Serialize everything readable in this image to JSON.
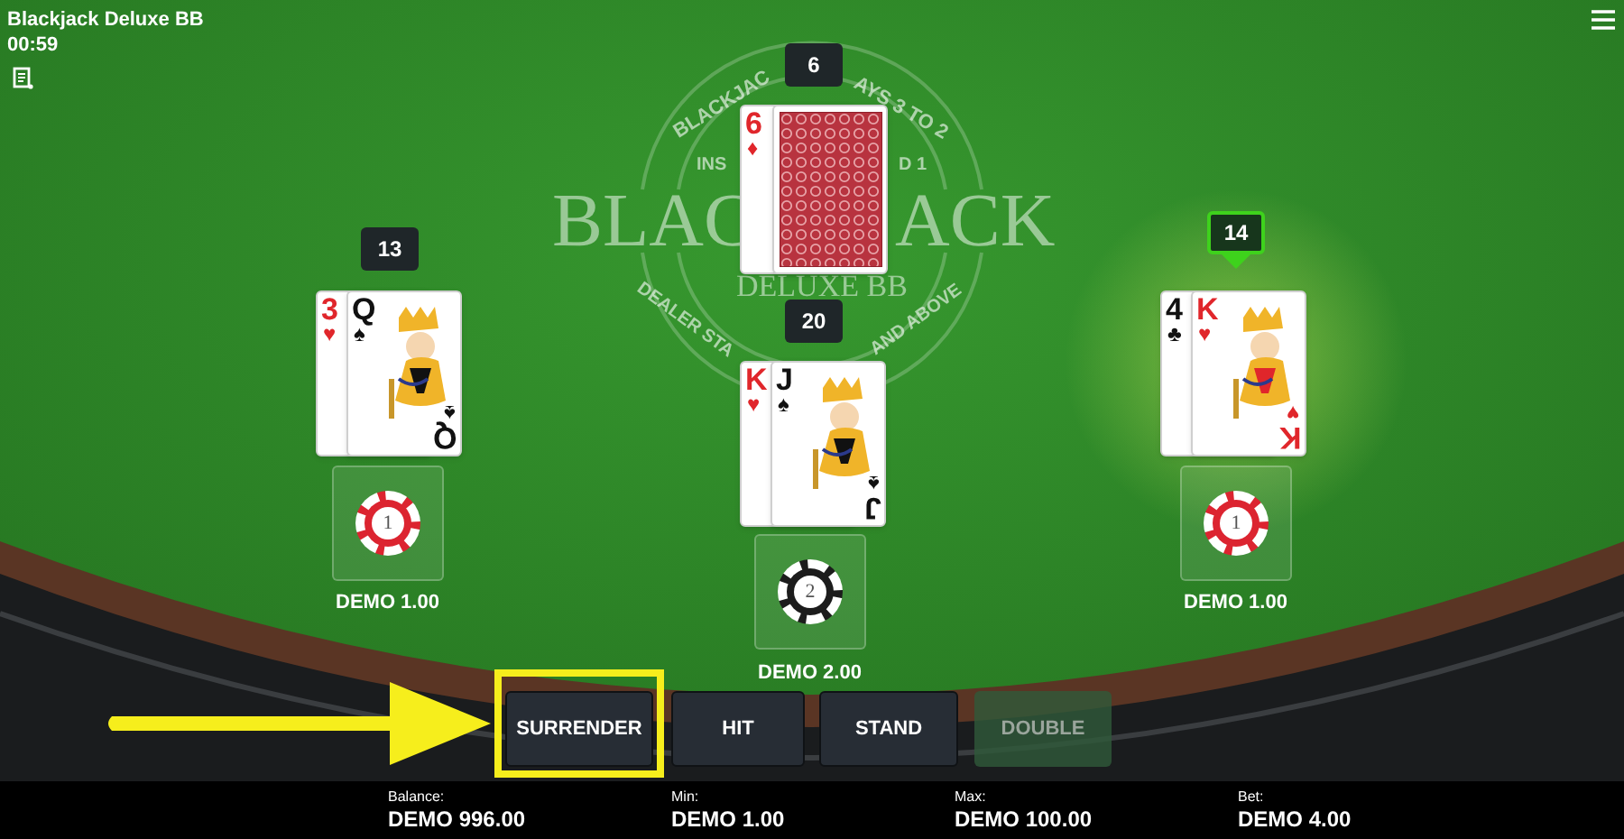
{
  "header": {
    "title": "Blackjack Deluxe BB",
    "timer": "00:59"
  },
  "table_logo": {
    "arc_top": [
      "BLACKJAC",
      "AYS 3 TO 2"
    ],
    "arc_inner": [
      "INS",
      "D 1"
    ],
    "name": [
      "BLAC",
      "ACK"
    ],
    "subtitle": "DELUXE BB",
    "arc_bottom": [
      "DEALER STA",
      "AND ABOVE"
    ]
  },
  "dealer": {
    "score": "6",
    "cards": [
      {
        "kind": "pip",
        "rank": "6",
        "suit": "♦",
        "color": "#e0262b"
      },
      {
        "kind": "back"
      }
    ]
  },
  "hands": [
    {
      "score": "13",
      "active": false,
      "bet": "DEMO 1.00",
      "chip": {
        "value": "1",
        "color": "#dc2430"
      },
      "cards": [
        {
          "kind": "pip",
          "rank": "3",
          "suit": "♥",
          "color": "#e0262b"
        },
        {
          "kind": "face",
          "rank": "Q",
          "suit": "♠",
          "color": "#111111",
          "bottom_suit": "♠",
          "bottom_rank": "Q"
        }
      ]
    },
    {
      "score": "20",
      "active": false,
      "bet": "DEMO 2.00",
      "chip": {
        "value": "2",
        "color": "#1c1c1c"
      },
      "cards": [
        {
          "kind": "pip",
          "rank": "K",
          "suit": "♥",
          "color": "#e0262b"
        },
        {
          "kind": "face",
          "rank": "J",
          "suit": "♠",
          "color": "#111111",
          "bottom_suit": "♠",
          "bottom_rank": "J"
        }
      ]
    },
    {
      "score": "14",
      "active": true,
      "bet": "DEMO 1.00",
      "chip": {
        "value": "1",
        "color": "#dc2430"
      },
      "cards": [
        {
          "kind": "pip",
          "rank": "4",
          "suit": "♣",
          "color": "#111111"
        },
        {
          "kind": "face",
          "rank": "K",
          "suit": "♥",
          "color": "#e0262b",
          "bottom_suit": "♥",
          "bottom_rank": "K"
        }
      ]
    }
  ],
  "buttons": [
    {
      "label": "SURRENDER",
      "disabled": false,
      "highlighted": true
    },
    {
      "label": "HIT",
      "disabled": false,
      "highlighted": false
    },
    {
      "label": "STAND",
      "disabled": false,
      "highlighted": false
    },
    {
      "label": "DOUBLE",
      "disabled": true,
      "highlighted": false
    }
  ],
  "status_bar": [
    {
      "label": "Balance:",
      "value": "DEMO 996.00"
    },
    {
      "label": "Min:",
      "value": "DEMO 1.00"
    },
    {
      "label": "Max:",
      "value": "DEMO 100.00"
    },
    {
      "label": "Bet:",
      "value": "DEMO 4.00"
    }
  ]
}
